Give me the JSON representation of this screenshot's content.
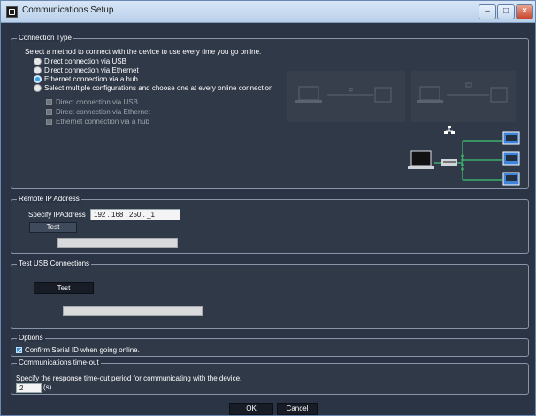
{
  "window": {
    "title": "Communications Setup"
  },
  "connection_type": {
    "legend": "Connection Type",
    "instruction": "Select a method to connect with the device to use every time you go online.",
    "options": [
      {
        "label": "Direct connection via USB",
        "selected": false
      },
      {
        "label": "Direct connection via Ethernet",
        "selected": false
      },
      {
        "label": "Ethernet connection via a hub",
        "selected": true
      },
      {
        "label": "Select multiple configurations and choose one at every online connection",
        "selected": false
      }
    ],
    "sub_options": [
      {
        "label": "Direct connection via USB"
      },
      {
        "label": "Direct connection via Ethernet"
      },
      {
        "label": "Ethernet connection via a hub"
      }
    ]
  },
  "remote_ip": {
    "legend": "Remote IP Address",
    "label": "Specify IPAddress",
    "value": "192 . 168 . 250 . _1",
    "test_label": "Test"
  },
  "usb_test": {
    "legend": "Test USB Connections",
    "test_label": "Test"
  },
  "options": {
    "legend": "Options",
    "confirm_serial": "Confirm Serial ID when going online.",
    "confirm_checked": true
  },
  "timeout": {
    "legend": "Communications time-out",
    "instruction": "Specify the response time-out period for communicating with the device.",
    "value": "2",
    "unit": "(s)"
  },
  "footer": {
    "ok_label": "OK",
    "cancel_label": "Cancel"
  },
  "icons": [
    "app-icon",
    "minimize-icon",
    "maximize-icon",
    "close-icon",
    "laptop-icon",
    "usb-icon",
    "network-icon",
    "controller-icon",
    "hub-icon"
  ]
}
